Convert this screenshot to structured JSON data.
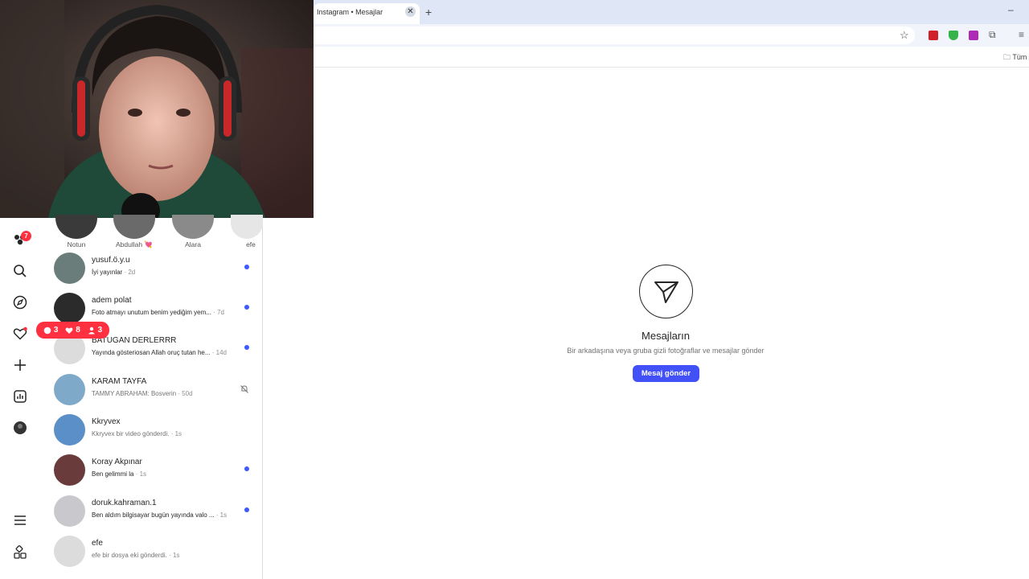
{
  "browser": {
    "tab_title": "Instagram • Mesajlar",
    "tab_close_glyph": "✕",
    "new_tab_glyph": "+",
    "minimize_glyph": "–",
    "bookmark_folder_label": "Tüm",
    "icons": [
      "star-icon",
      "pdf-extension-icon",
      "shield-extension-icon",
      "purple-extension-icon",
      "puzzle-icon",
      "reading-list-icon",
      "folder-icon"
    ]
  },
  "nav": {
    "threads_badge": "7",
    "icons": [
      "threads-icon",
      "search-icon",
      "explore-icon",
      "heart-icon",
      "create-icon",
      "insights-icon",
      "profile-avatar",
      "menu-icon",
      "more-apps-icon"
    ]
  },
  "notifications": {
    "comments": "3",
    "likes": "8",
    "followers": "3"
  },
  "notes": [
    {
      "name": "Notun"
    },
    {
      "name": "Abdullah 💘"
    },
    {
      "name": "Alara"
    },
    {
      "name": "efe"
    }
  ],
  "conversations": [
    {
      "name": "yusuf.ö.y.u",
      "preview": "İyi yayınlar",
      "time": " · 2d",
      "unread": true,
      "muted": false,
      "avatar_color": "#6b7d7a"
    },
    {
      "name": "adem polat",
      "preview": "Foto atmayı unutum benim yediğim yem...",
      "time": " · 7d",
      "unread": true,
      "muted": false,
      "avatar_color": "#2b2b2b"
    },
    {
      "name": "BATUGAN DERLERRR",
      "preview": "Yayında gösteriosan Allah oruç tutan he...",
      "time": " · 14d",
      "unread": true,
      "muted": false,
      "avatar_color": "#dcdcdc"
    },
    {
      "name": "KARAM TAYFA",
      "preview": "TAMMY ABRAHAM: Bosverin",
      "time": " · 50d",
      "unread": false,
      "muted": true,
      "avatar_color": "#7fa9c9"
    },
    {
      "name": "Kkryvex",
      "preview": "Kkryvex bir video gönderdi.",
      "time": " · 1s",
      "unread": false,
      "muted": false,
      "avatar_color": "#5b8fc8"
    },
    {
      "name": "Koray Akpınar",
      "preview": "Ben gelimmi la",
      "time": " · 1s",
      "unread": true,
      "muted": false,
      "avatar_color": "#6a3b3b"
    },
    {
      "name": "doruk.kahraman.1",
      "preview": "Ben aldım bilgisayar bugün yayında valo ...",
      "time": " · 1s",
      "unread": true,
      "muted": false,
      "avatar_color": "#c9c9cd"
    },
    {
      "name": "efe",
      "preview": "efe bir dosya eki gönderdi.",
      "time": " · 1s",
      "unread": false,
      "muted": false,
      "avatar_color": "#dcdcdc"
    }
  ],
  "empty_state": {
    "title": "Mesajların",
    "subtitle": "Bir arkadaşına veya gruba gizli fotoğraflar ve mesajlar gönder",
    "button": "Mesaj gönder"
  },
  "colors": {
    "accent_blue": "#4150f7",
    "unread_dot": "#3d5afe",
    "badge_red": "#ff3040"
  }
}
